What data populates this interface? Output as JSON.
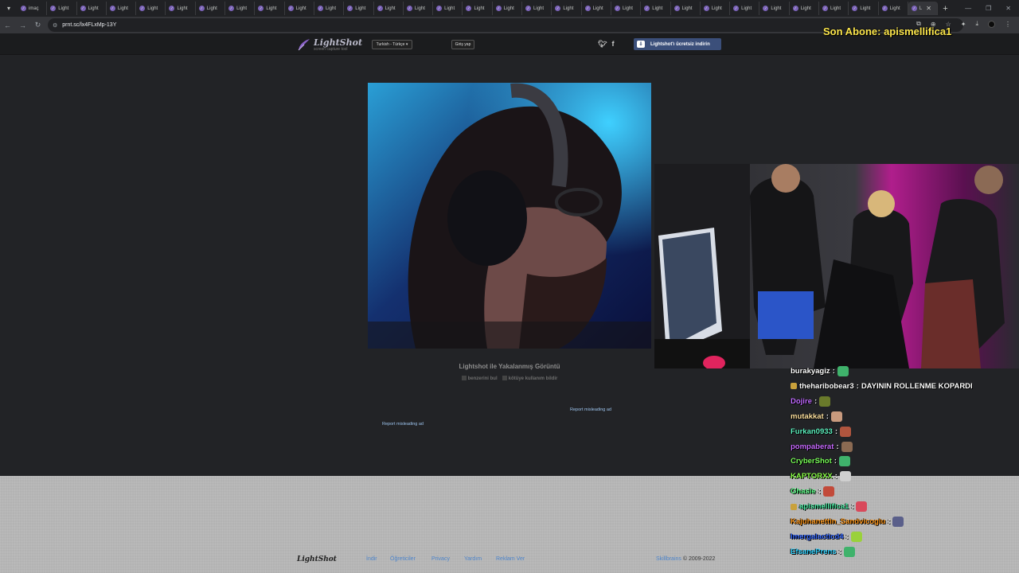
{
  "browser": {
    "tabs": [
      {
        "label": "imaç",
        "active": false
      },
      {
        "label": "Light",
        "active": false
      },
      {
        "label": "Light",
        "active": false
      },
      {
        "label": "Light",
        "active": false
      },
      {
        "label": "Light",
        "active": false
      },
      {
        "label": "Light",
        "active": false
      },
      {
        "label": "Light",
        "active": false
      },
      {
        "label": "Light",
        "active": false
      },
      {
        "label": "Light",
        "active": false
      },
      {
        "label": "Light",
        "active": false
      },
      {
        "label": "Light",
        "active": false
      },
      {
        "label": "Light",
        "active": false
      },
      {
        "label": "Light",
        "active": false
      },
      {
        "label": "Light",
        "active": false
      },
      {
        "label": "Light",
        "active": false
      },
      {
        "label": "Light",
        "active": false
      },
      {
        "label": "Light",
        "active": false
      },
      {
        "label": "Light",
        "active": false
      },
      {
        "label": "Light",
        "active": false
      },
      {
        "label": "Light",
        "active": false
      },
      {
        "label": "Light",
        "active": false
      },
      {
        "label": "Light",
        "active": false
      },
      {
        "label": "Light",
        "active": false
      },
      {
        "label": "Light",
        "active": false
      },
      {
        "label": "Light",
        "active": false
      },
      {
        "label": "Light",
        "active": false
      },
      {
        "label": "Light",
        "active": false
      },
      {
        "label": "Light",
        "active": false
      },
      {
        "label": "Light",
        "active": false
      },
      {
        "label": "Light",
        "active": false
      },
      {
        "label": "L",
        "active": true
      }
    ],
    "url": "prnt.sc/lx4FLxMp-13Y"
  },
  "lightshot": {
    "logo_name": "LightShot",
    "logo_tagline": "screen capture tool",
    "language": "Turkish - Türkçe",
    "login": "Giriş yap",
    "download": "Lightshot'ı ücretsiz indirin",
    "caption": "Lightshot ile Yakalanmış Görüntü",
    "find_similar": "benzerini bul",
    "report_abuse": "kötüye kullanım bildir",
    "report_ad_1": "Report misleading ad",
    "report_ad_2": "Report misleading ad"
  },
  "footer": {
    "logo": "LightShot",
    "links": [
      "İndir",
      "Öğreticiler",
      "Privacy",
      "Yardım",
      "Reklam Ver"
    ],
    "company": "Skillbrains",
    "copyright": "© 2009-2022"
  },
  "stream": {
    "last_sub": "Son Abone: apismellifica1",
    "chat": [
      {
        "user": "burakyagiz",
        "color": "#ffffff",
        "message": "",
        "emote": "#3fb26b",
        "badge": false
      },
      {
        "user": "theharibobear3",
        "color": "#ffffff",
        "message": "DAYININ ROLLENME KOPARDI",
        "emote": "",
        "badge": true
      },
      {
        "user": "Dojire",
        "color": "#c06bff",
        "message": "",
        "emote": "#6a7a2b",
        "badge": false
      },
      {
        "user": "mutakkat",
        "color": "#ffe2a0",
        "message": "",
        "emote": "#c89a7e",
        "badge": false
      },
      {
        "user": "Furkan0933",
        "color": "#5ef2c0",
        "message": "",
        "emote": "#b0553e",
        "badge": false
      },
      {
        "user": "pompaberat",
        "color": "#c86bff",
        "message": "",
        "emote": "#8b6a52",
        "badge": false
      },
      {
        "user": "CryberShot",
        "color": "#7aff5a",
        "message": "",
        "emote": "#3fb26b",
        "badge": false
      },
      {
        "user": "KAPTORXX",
        "color": "#8bff4a",
        "message": "",
        "emote": "#cfcfcf",
        "badge": false
      },
      {
        "user": "Ghasie",
        "color": "#5eff8a",
        "message": "",
        "emote": "#c24a3a",
        "badge": false
      },
      {
        "user": "apismellifica1",
        "color": "#4ff0a8",
        "message": "",
        "emote": "#d9495b",
        "badge": true
      },
      {
        "user": "Kajuhanettin_Sandvicoglu",
        "color": "#ff9a1f",
        "message": "",
        "emote": "#5a5f8a",
        "badge": false
      },
      {
        "user": "Imergalacticd4",
        "color": "#3a6cff",
        "message": "",
        "emote": "#9ad13a",
        "badge": false
      },
      {
        "user": "EfsanePrens",
        "color": "#34d3ff",
        "message": "",
        "emote": "#3fb26b",
        "badge": false
      }
    ]
  }
}
